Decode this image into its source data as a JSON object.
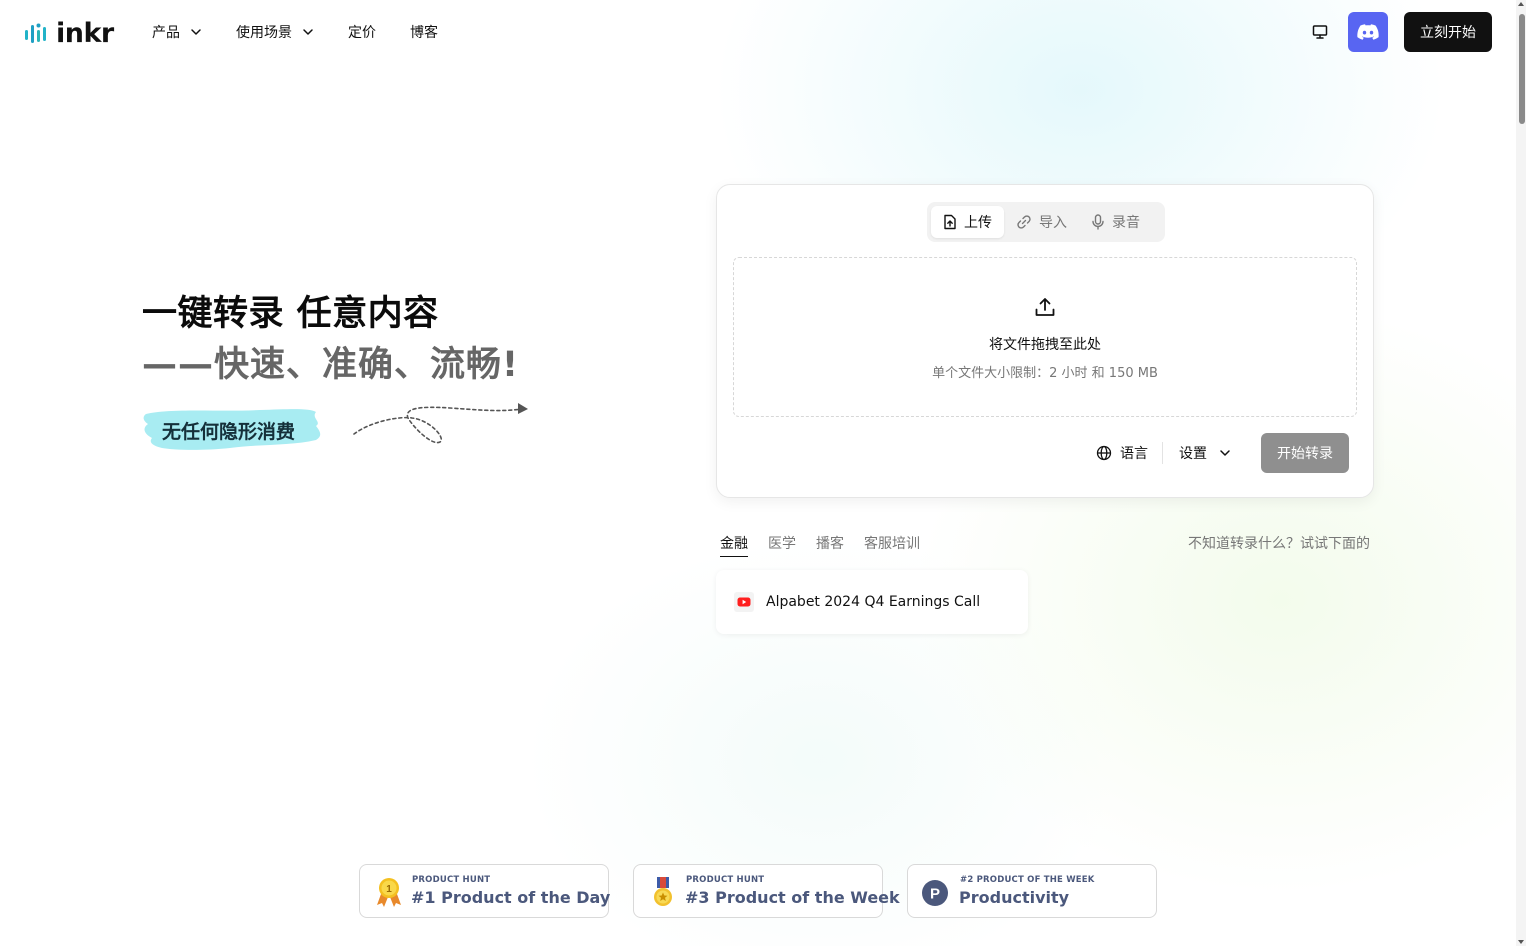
{
  "brand": {
    "name": "inkr",
    "color": "#111111",
    "logo_icon": "soundwave-icon"
  },
  "nav": {
    "items": [
      {
        "label": "产品",
        "has_dropdown": true
      },
      {
        "label": "使用场景",
        "has_dropdown": true
      },
      {
        "label": "定价",
        "has_dropdown": false
      },
      {
        "label": "博客",
        "has_dropdown": false
      }
    ]
  },
  "header": {
    "monitor_icon": "monitor-icon",
    "discord_icon": "discord-icon",
    "discord_color": "#5865F2",
    "cta_label": "立刻开始"
  },
  "hero": {
    "title": "一键转录 任意内容",
    "subtitle": "——快速、准确、流畅!",
    "badge": "无任何隐形消费",
    "badge_color": "#A8ECF2"
  },
  "upload": {
    "tabs": [
      {
        "label": "上传",
        "icon": "file-upload-icon",
        "active": true
      },
      {
        "label": "导入",
        "icon": "link-icon",
        "active": false
      },
      {
        "label": "录音",
        "icon": "microphone-icon",
        "active": false
      }
    ],
    "drop_title": "将文件拖拽至此处",
    "drop_limit": "单个文件大小限制：2 小时 和 150 MB",
    "language_label": "语言",
    "settings_label": "设置",
    "start_label": "开始转录"
  },
  "examples": {
    "categories": [
      {
        "label": "金融",
        "active": true
      },
      {
        "label": "医学",
        "active": false
      },
      {
        "label": "播客",
        "active": false
      },
      {
        "label": "客服培训",
        "active": false
      }
    ],
    "hint": "不知道转录什么？试试下面的",
    "items": [
      {
        "title": "Alpabet 2024 Q4 Earnings Call",
        "icon": "youtube-icon"
      }
    ]
  },
  "awards": [
    {
      "kicker": "PRODUCT HUNT",
      "title": "#1 Product of the Day",
      "icon": "gold-medal-icon"
    },
    {
      "kicker": "PRODUCT HUNT",
      "title": "#3 Product of the Week",
      "icon": "bronze-medal-icon"
    },
    {
      "kicker": "#2 PRODUCT OF THE WEEK",
      "title": "Productivity",
      "icon": "product-hunt-icon"
    }
  ]
}
